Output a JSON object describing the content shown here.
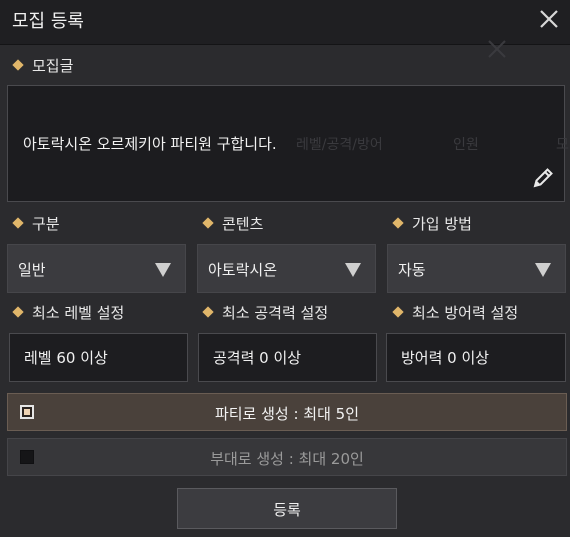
{
  "window": {
    "title": "모집 등록"
  },
  "post": {
    "section_label": "모집글",
    "text": "아토락시온 오르제키아 파티원 구합니다.",
    "ghost_text_1": "레벨/공격/방어",
    "ghost_text_2": "인원",
    "ghost_text_3": "모"
  },
  "selects": [
    {
      "label": "구분",
      "value": "일반"
    },
    {
      "label": "콘텐츠",
      "value": "아토락시온"
    },
    {
      "label": "가입 방법",
      "value": "자동"
    }
  ],
  "requirements": [
    {
      "label": "최소 레벨 설정",
      "value": "레벨  60 이상"
    },
    {
      "label": "최소 공격력 설정",
      "value": "공격력  0 이상"
    },
    {
      "label": "최소 방어력 설정",
      "value": "방어력  0 이상"
    }
  ],
  "group_type": {
    "options": [
      {
        "label": "파티로 생성 : 최대 5인",
        "checked": true
      },
      {
        "label": "부대로 생성 : 최대 20인",
        "checked": false
      }
    ]
  },
  "submit_label": "등록",
  "colors": {
    "accent": "#e0b66a",
    "selected_row": "#4a413b"
  }
}
